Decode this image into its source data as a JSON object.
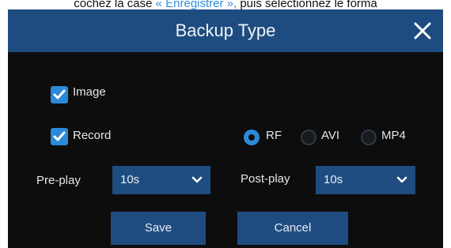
{
  "caption": {
    "before": "cochez la case ",
    "link": "« Enregistrer »,",
    "after": " puis sélectionnez le forma"
  },
  "dialog": {
    "title": "Backup Type",
    "close_icon": "close-icon"
  },
  "options": {
    "image": {
      "label": "Image",
      "checked": true
    },
    "record": {
      "label": "Record",
      "checked": true
    },
    "formats": [
      {
        "label": "RF",
        "selected": true
      },
      {
        "label": "AVI",
        "selected": false
      },
      {
        "label": "MP4",
        "selected": false
      }
    ]
  },
  "pre_play": {
    "label": "Pre-play",
    "value": "10s"
  },
  "post_play": {
    "label": "Post-play",
    "value": "10s"
  },
  "buttons": {
    "save": "Save",
    "cancel": "Cancel"
  },
  "colors": {
    "accent": "#2a8ad8",
    "titlebar": "#1f4c80",
    "background": "#0d0d0d"
  }
}
